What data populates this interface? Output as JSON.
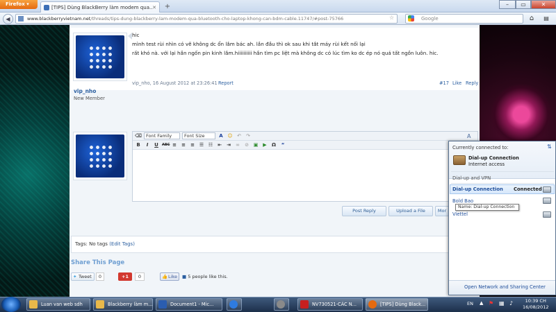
{
  "browser": {
    "menu_button": "Firefox",
    "tab_title": "[TIPS] Dùng BlackBerry làm modem qua...",
    "new_tab": "+",
    "url_domain": "www.blackberryvietnam.net",
    "url_path": "/threads/tips-dung-blackberry-lam-modem-qua-bluetooth-cho-laptop-khong-can-bdm-cable.11747/#post-75766",
    "search_placeholder": "Google"
  },
  "post": {
    "username": "vip_nho",
    "user_title": "New Member",
    "lines": [
      "hic",
      "mình test rùi nhìn có vẽ không dc ổn lắm bác ah. lần đầu thì ok sau khi tắt máy rùi kết nối lại",
      "rất khó nà. với lại hần ngốn pin kinh lắm.hiiiiiiiiii hần tìm pc liệt mà không dc có lúc tìm ko dc ép nó quá tất ngồn luôn. hic."
    ],
    "meta": "vip_nho, 16 August 2012 at 23:26:41",
    "report": "Report",
    "post_number": "#17",
    "like": "Like",
    "reply": "Reply"
  },
  "editor": {
    "font_family": "Font Family",
    "font_size": "Font Size",
    "post_reply": "Post Reply",
    "upload_file": "Upload a File",
    "more": "Mor"
  },
  "tags": {
    "label": "Tags: No tags",
    "edit": "(Edit Tags)"
  },
  "share": {
    "heading": "Share This Page",
    "tweet": "Tweet",
    "tweet_count": "0",
    "gplus": "+1",
    "gplus_count": "0",
    "like": "Like",
    "like_text": "5 people like this."
  },
  "network": {
    "currently": "Currently connected to:",
    "conn_name": "Dial-up Connection",
    "conn_sub": "Internet access",
    "section": "Dial-up and VPN",
    "items": [
      {
        "name": "Dial-up Connection",
        "status": "Connected"
      },
      {
        "name": "Bold Bao",
        "status": ""
      },
      {
        "name": "Viettel",
        "status": ""
      }
    ],
    "tooltip": "Name: Dial-up Connection",
    "footer": "Open Network and Sharing Center"
  },
  "taskbar": {
    "items": [
      {
        "label": "Luan van web sdh",
        "color": "#e8b84a"
      },
      {
        "label": "Blackberry làm m...",
        "color": "#e8b84a"
      },
      {
        "label": "Document1 - Mic...",
        "color": "#2a5db0"
      },
      {
        "label": "",
        "color": "#2e7be0"
      },
      {
        "label": "",
        "color": "#8a8a8a"
      },
      {
        "label": "NV730521-CÁC N...",
        "color": "#c62020"
      },
      {
        "label": "[TIPS] Dùng Black...",
        "color": "#e56a10"
      }
    ],
    "lang": "EN",
    "time": "10:39 CH",
    "date": "16/08/2012"
  }
}
